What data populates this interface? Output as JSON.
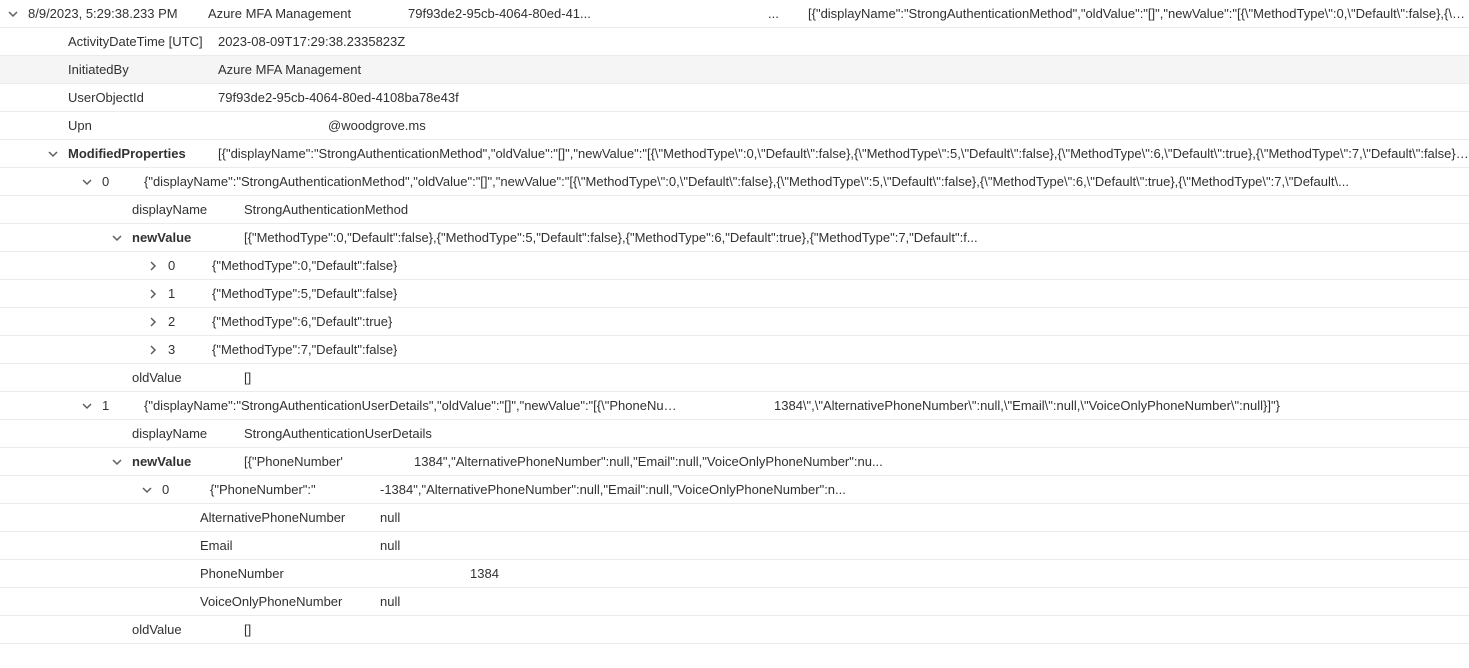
{
  "header": {
    "timestamp": "8/9/2023, 5:29:38.233 PM",
    "service": "Azure MFA Management",
    "objectId": "79f93de2-95cb-4064-80ed-41...",
    "ellipsis": "...",
    "json_preview": "[{\"displayName\":\"StrongAuthenticationMethod\",\"oldValue\":\"[]\",\"newValue\":\"[{\\\"MethodType\\\":0,\\\"Default\\\":false},{\\\"Meth"
  },
  "fields": {
    "activityDateTime_label": "ActivityDateTime [UTC]",
    "activityDateTime_value": "2023-08-09T17:29:38.2335823Z",
    "initiatedBy_label": "InitiatedBy",
    "initiatedBy_value": "Azure MFA Management",
    "userObjectId_label": "UserObjectId",
    "userObjectId_value": "79f93de2-95cb-4064-80ed-4108ba78e43f",
    "upn_label": "Upn",
    "upn_value": "@woodgrove.ms"
  },
  "modifiedProperties": {
    "label": "ModifiedProperties",
    "summary": "[{\"displayName\":\"StrongAuthenticationMethod\",\"oldValue\":\"[]\",\"newValue\":\"[{\\\"MethodType\\\":0,\\\"Default\\\":false},{\\\"MethodType\\\":5,\\\"Default\\\":false},{\\\"MethodType\\\":6,\\\"Default\\\":true},{\\\"MethodType\\\":7,\\\"Default\\\":false}]\"},{\"d"
  },
  "item0": {
    "index": "0",
    "summary": "{\"displayName\":\"StrongAuthenticationMethod\",\"oldValue\":\"[]\",\"newValue\":\"[{\\\"MethodType\\\":0,\\\"Default\\\":false},{\\\"MethodType\\\":5,\\\"Default\\\":false},{\\\"MethodType\\\":6,\\\"Default\\\":true},{\\\"MethodType\\\":7,\\\"Default\\...",
    "displayName_label": "displayName",
    "displayName_value": "StrongAuthenticationMethod",
    "newValue_label": "newValue",
    "newValue_summary": "[{\"MethodType\":0,\"Default\":false},{\"MethodType\":5,\"Default\":false},{\"MethodType\":6,\"Default\":true},{\"MethodType\":7,\"Default\":f...",
    "nv": [
      {
        "idx": "0",
        "val": "{\"MethodType\":0,\"Default\":false}"
      },
      {
        "idx": "1",
        "val": "{\"MethodType\":5,\"Default\":false}"
      },
      {
        "idx": "2",
        "val": "{\"MethodType\":6,\"Default\":true}"
      },
      {
        "idx": "3",
        "val": "{\"MethodType\":7,\"Default\":false}"
      }
    ],
    "oldValue_label": "oldValue",
    "oldValue_value": "[]"
  },
  "item1": {
    "index": "1",
    "summary_left": "{\"displayName\":\"StrongAuthenticationUserDetails\",\"oldValue\":\"[]\",\"newValue\":\"[{\\\"PhoneNumbe",
    "summary_right": "1384\\\",\\\"AlternativePhoneNumber\\\":null,\\\"Email\\\":null,\\\"VoiceOnlyPhoneNumber\\\":null}]\"}",
    "displayName_label": "displayName",
    "displayName_value": "StrongAuthenticationUserDetails",
    "newValue_label": "newValue",
    "newValue_summary_left": "[{\"PhoneNumber'",
    "newValue_summary_right": "1384\",\"AlternativePhoneNumber\":null,\"Email\":null,\"VoiceOnlyPhoneNumber\":nu...",
    "nv0_idx": "0",
    "nv0_left": "{\"PhoneNumber\":\"",
    "nv0_right": "-1384\",\"AlternativePhoneNumber\":null,\"Email\":null,\"VoiceOnlyPhoneNumber\":n...",
    "fields": {
      "altPhone_label": "AlternativePhoneNumber",
      "altPhone_value": "null",
      "email_label": "Email",
      "email_value": "null",
      "phone_label": "PhoneNumber",
      "phone_value": "1384",
      "voice_label": "VoiceOnlyPhoneNumber",
      "voice_value": "null"
    },
    "oldValue_label": "oldValue",
    "oldValue_value": "[]"
  }
}
